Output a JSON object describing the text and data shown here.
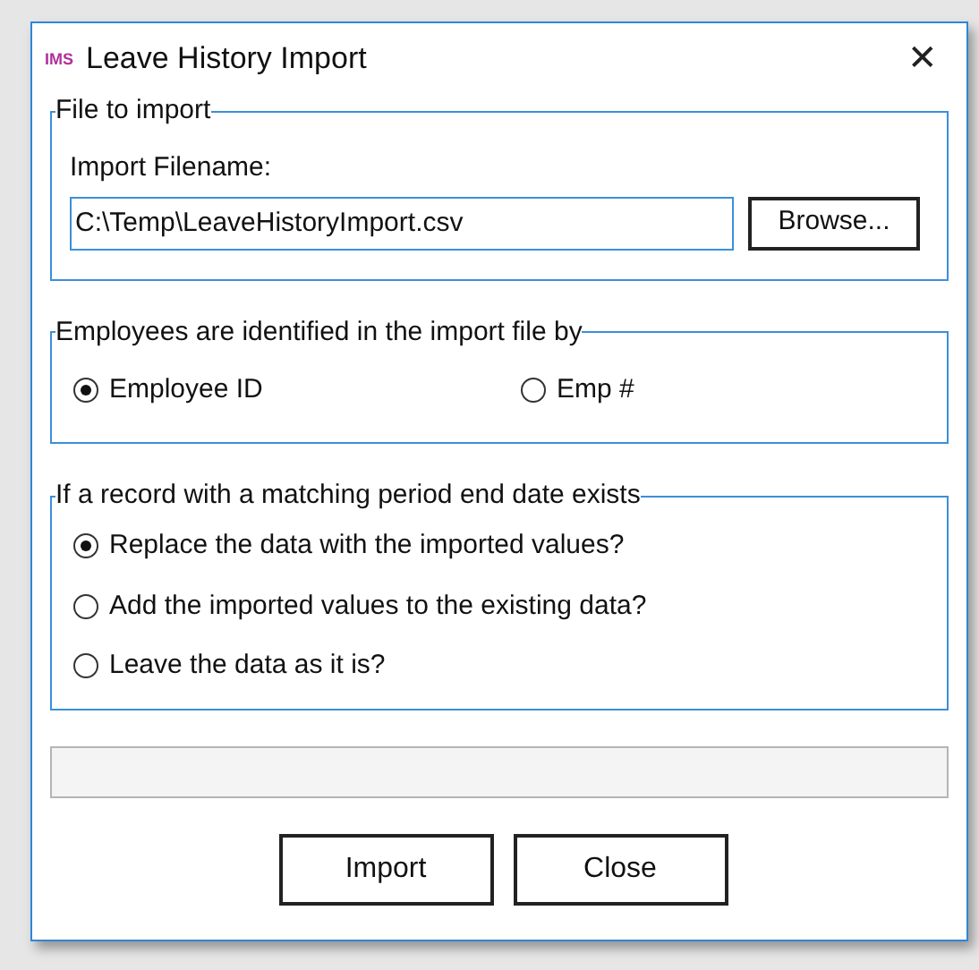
{
  "window": {
    "logo": "IMS",
    "title": "Leave History Import",
    "close": "✕"
  },
  "file_group": {
    "title": "File to import",
    "label": "Import Filename:",
    "value": "C:\\Temp\\LeaveHistoryImport.csv",
    "browse": "Browse..."
  },
  "id_group": {
    "title": "Employees are identified in the import file by",
    "options": [
      {
        "label": "Employee ID",
        "selected": true
      },
      {
        "label": "Emp #",
        "selected": false
      }
    ]
  },
  "match_group": {
    "title": "If a record with a matching period end date exists",
    "options": [
      {
        "label": "Replace the data with the imported values?",
        "selected": true
      },
      {
        "label": "Add the imported values to the existing data?",
        "selected": false
      },
      {
        "label": "Leave the data as it is?",
        "selected": false
      }
    ]
  },
  "buttons": [
    "Import",
    "Close"
  ]
}
